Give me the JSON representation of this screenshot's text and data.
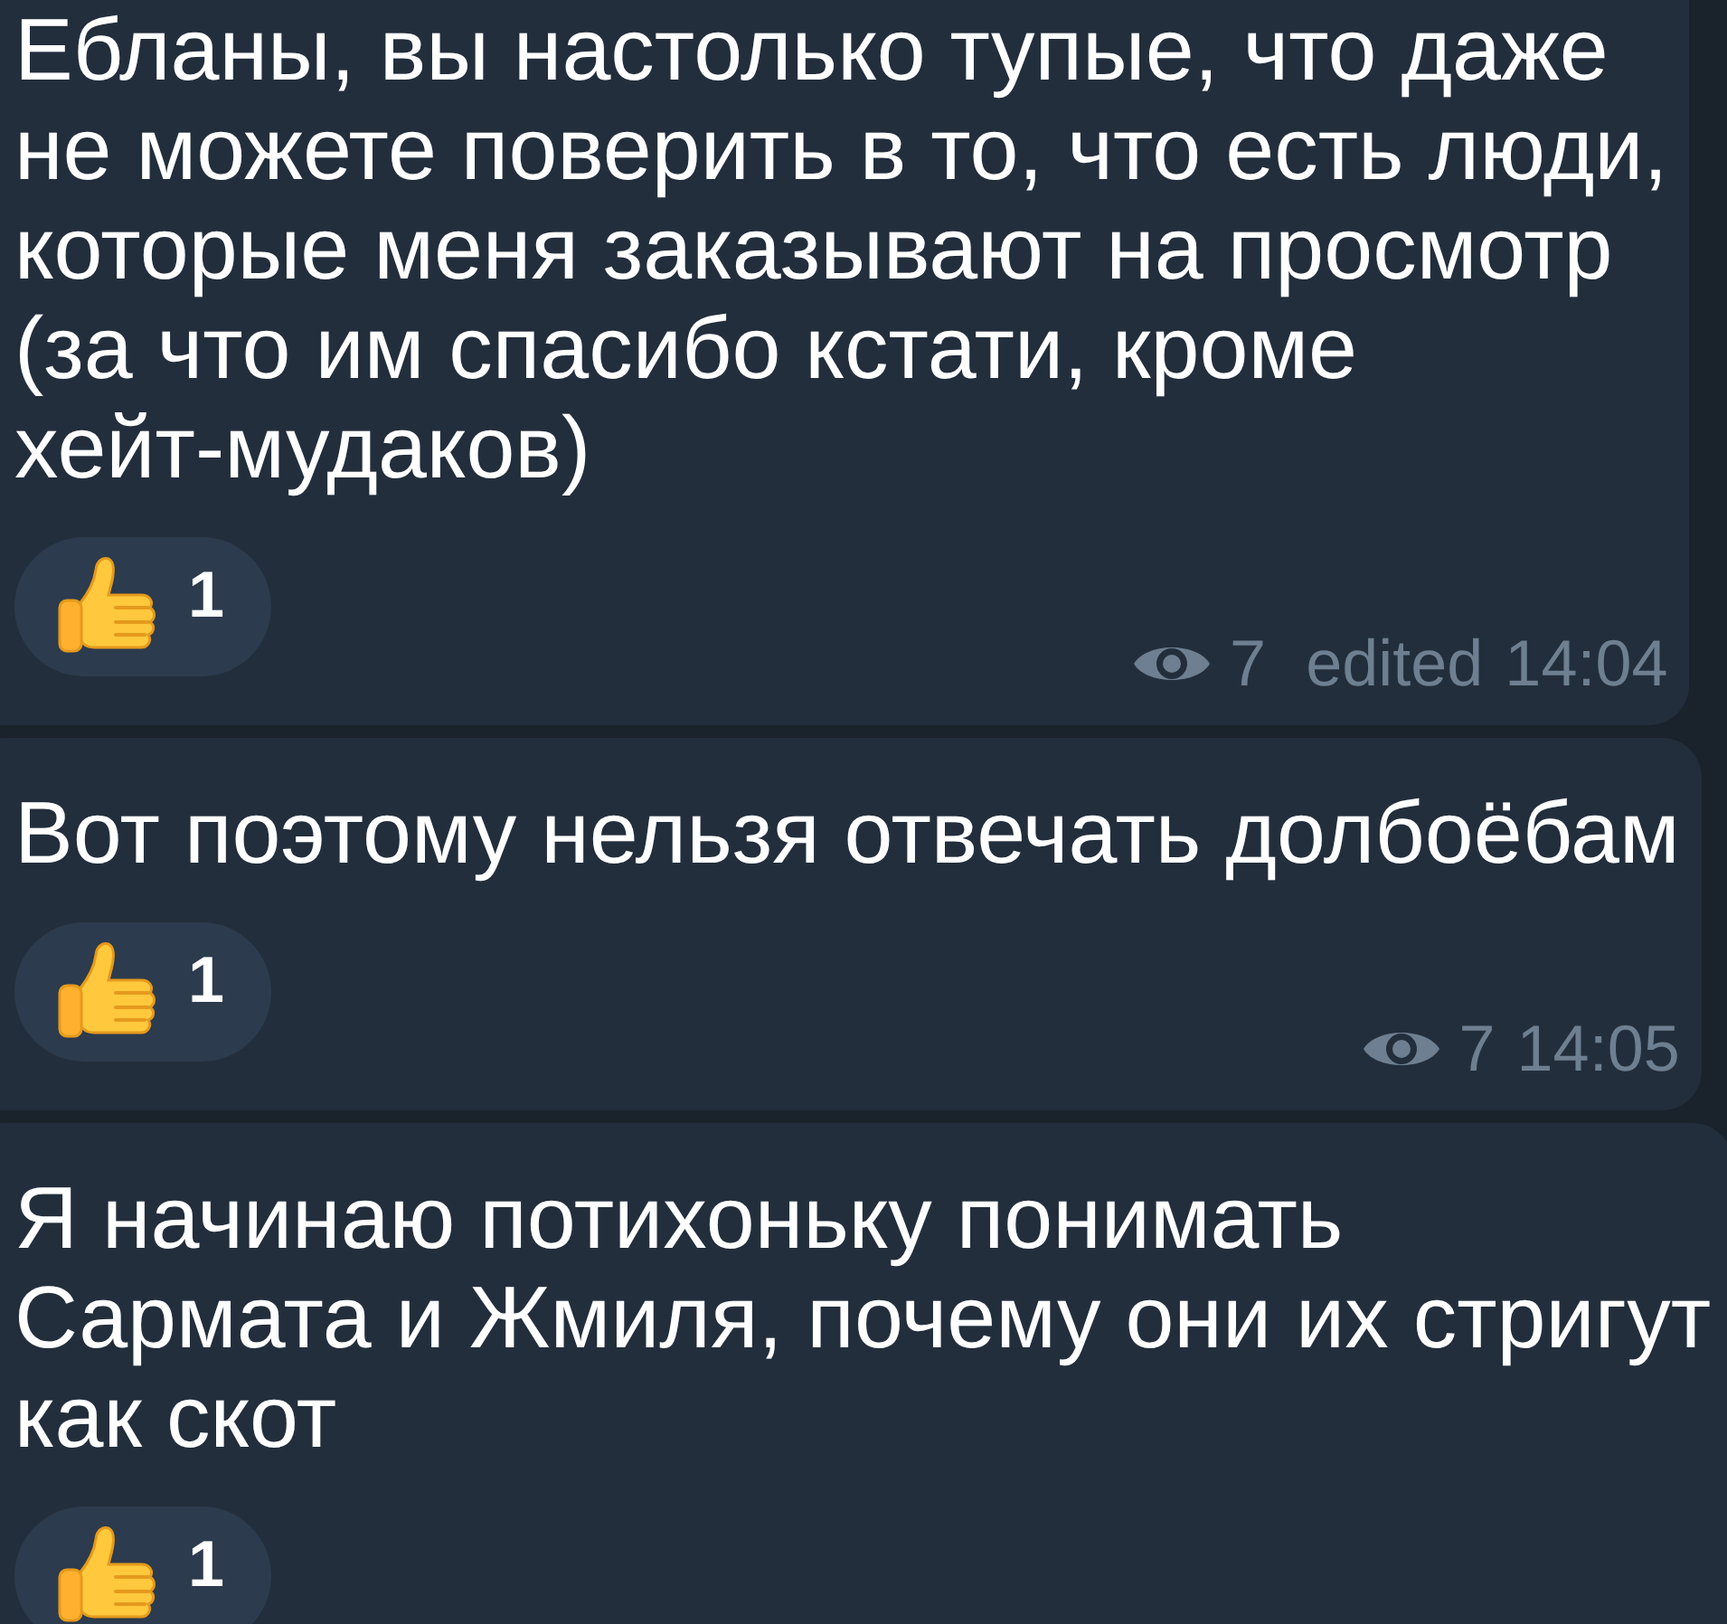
{
  "messages": [
    {
      "text": "Ебланы, вы настолько тупые, что даже\nне можете поверить в то, что есть люди,\nкоторые меня заказывают на просмотр\n(за что им спасибо кстати, кроме\nхейт-мудаков)",
      "reactions": [
        {
          "count": "1"
        }
      ],
      "views": "7",
      "edited": "edited",
      "time": "14:04"
    },
    {
      "text": "Вот поэтому нельзя отвечать долбоёбам",
      "reactions": [
        {
          "count": "1"
        }
      ],
      "views": "7",
      "time": "14:05"
    },
    {
      "text": "Я начинаю потихоньку понимать\nСармата и Жмиля, почему они их стригут\nкак скот",
      "reactions": [
        {
          "count": "1"
        }
      ]
    }
  ]
}
